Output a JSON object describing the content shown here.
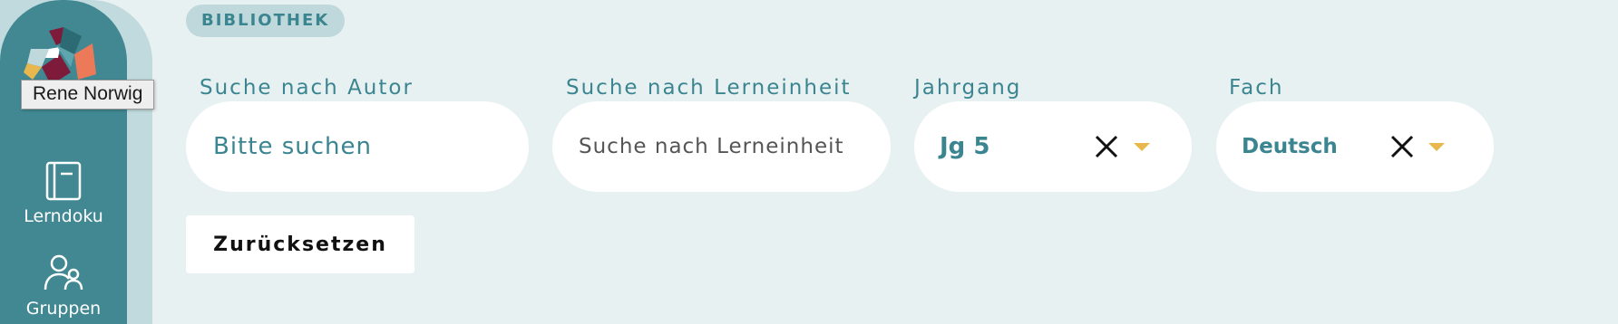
{
  "sidebar": {
    "tooltip": "Rene Norwig",
    "items": [
      {
        "label": "Lerndoku",
        "icon": "book-icon"
      },
      {
        "label": "Gruppen",
        "icon": "users-icon"
      }
    ]
  },
  "header": {
    "badge": "BIBLIOTHEK"
  },
  "filters": {
    "autor": {
      "label": "Suche nach Autor",
      "placeholder": "Bitte suchen"
    },
    "lerneinheit": {
      "label": "Suche nach Lerneinheit",
      "placeholder": "Suche nach Lerneinheit"
    },
    "jahrgang": {
      "label": "Jahrgang",
      "value": "Jg 5"
    },
    "fach": {
      "label": "Fach",
      "value": "Deutsch"
    },
    "reset_label": "Zurücksetzen"
  },
  "colors": {
    "background": "#e8f1f2",
    "sidebar": "#418893",
    "accent_text": "#3a8590",
    "caret": "#e8b84f"
  }
}
